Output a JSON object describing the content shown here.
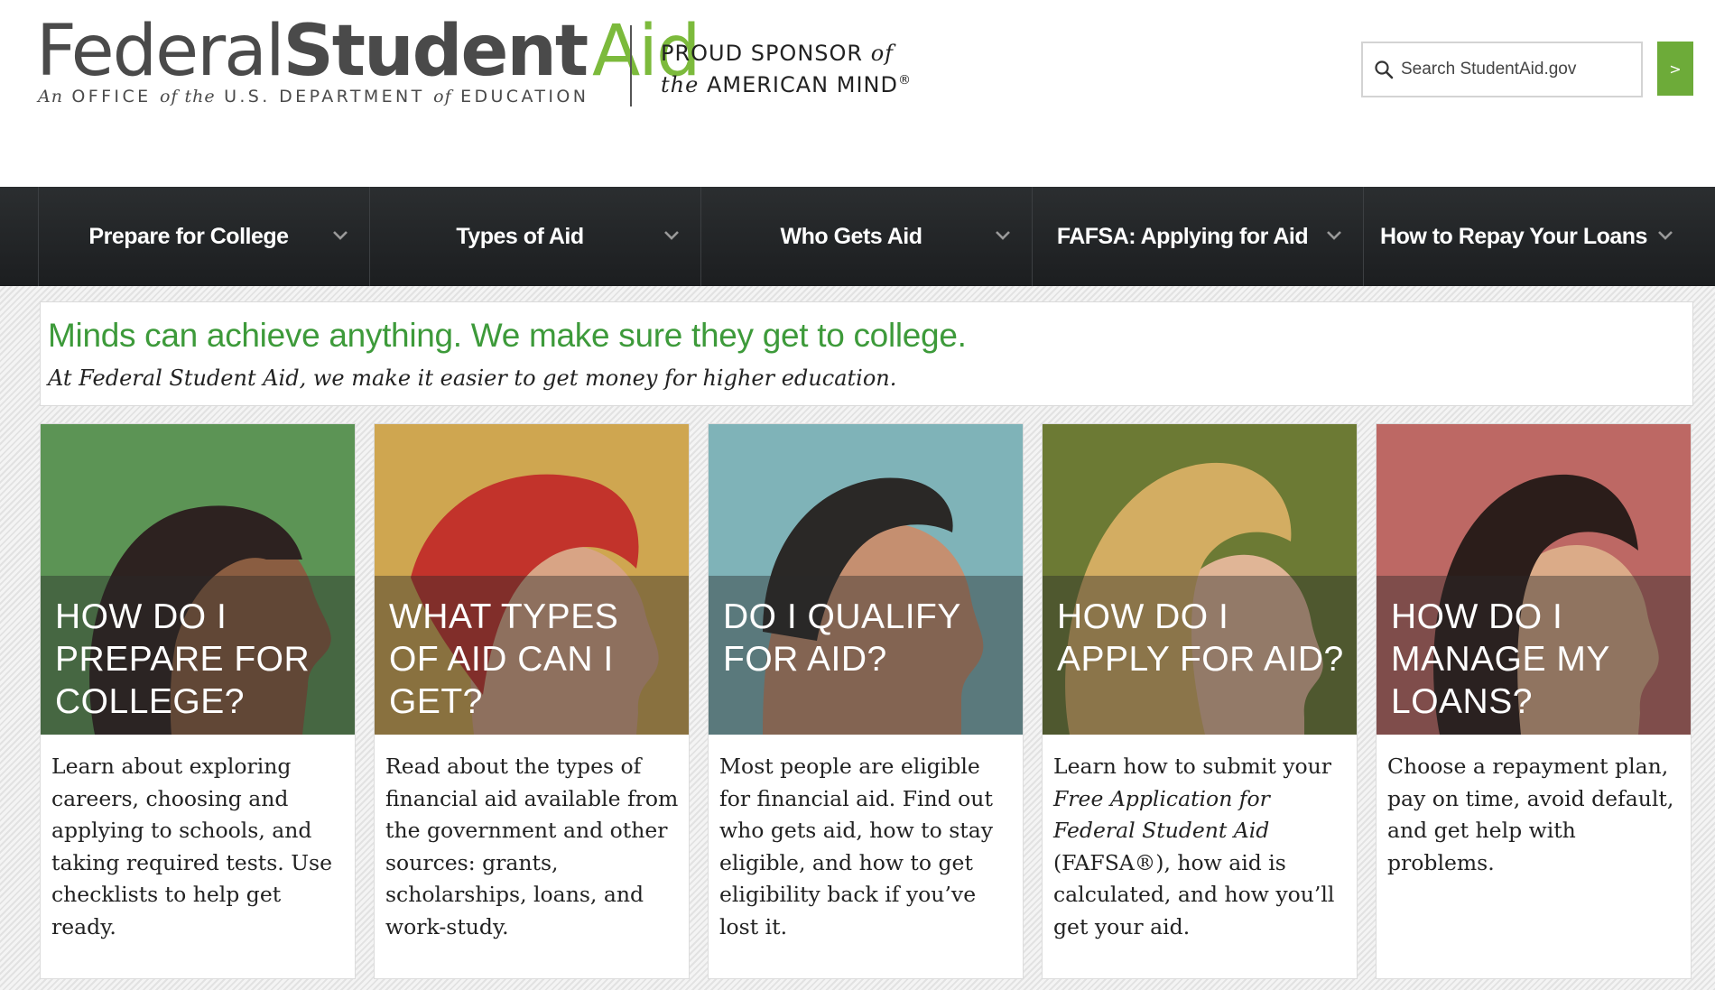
{
  "logo": {
    "word1": "Federal",
    "word2": "Student",
    "word3": "Aid",
    "tagline_1": "An",
    "tagline_2": "OFFICE",
    "tagline_3": "of the",
    "tagline_4": "U.S. DEPARTMENT",
    "tagline_5": "of",
    "tagline_6": "EDUCATION"
  },
  "sponsor": {
    "line1_a": "PROUD SPONSOR",
    "line1_b": "of",
    "line2_a": "the",
    "line2_b": "AMERICAN MIND",
    "line2_mark": "®"
  },
  "search": {
    "placeholder": "Search StudentAid.gov",
    "go_label": ">",
    "icon": "search-icon"
  },
  "nav": {
    "items": [
      {
        "label": "Prepare for College",
        "icon": "chevron-down-icon"
      },
      {
        "label": "Types of Aid",
        "icon": "chevron-down-icon"
      },
      {
        "label": "Who Gets Aid",
        "icon": "chevron-down-icon"
      },
      {
        "label": "FAFSA: Applying for Aid",
        "icon": "chevron-down-icon"
      },
      {
        "label": "How to Repay Your Loans",
        "icon": "chevron-down-icon"
      }
    ]
  },
  "hero": {
    "title": "Minds can achieve anything. We make sure they get to college.",
    "subtitle": "At Federal Student Aid, we make it easier to get money for higher education."
  },
  "cards": [
    {
      "question": "How do I prepare for college?",
      "description": "Learn about exploring careers, choosing and applying to schools, and taking required tests.  Use checklists to help get ready.",
      "bg": "#5c9455"
    },
    {
      "question": "What types of aid can I get?",
      "description": "Read about the types of financial aid available from the government and other sources: grants, scholarships, loans, and work-study.",
      "bg": "#cfa650"
    },
    {
      "question": "Do I qualify for aid?",
      "description": "Most people are eligible for financial aid. Find out who gets aid, how to stay eligible, and how to get eligibility back if you’ve lost it.",
      "bg": "#7fb3b8"
    },
    {
      "question": "How do I apply for aid?",
      "desc_pre": "Learn how to submit your ",
      "desc_italic": "Free Application for Federal Student Aid",
      "desc_post": " (FAFSA®), how aid is calculated, and how you’ll get your aid.",
      "bg": "#6c7a34"
    },
    {
      "question": "How do I manage my loans?",
      "description": "Choose a repayment plan, pay on time, avoid default, and get help with problems.",
      "bg": "#bd6864"
    }
  ],
  "colors": {
    "brand_green": "#7cba3c",
    "hero_green": "#3d9a3a",
    "nav_bg": "#232628",
    "search_button": "#6dab39"
  }
}
